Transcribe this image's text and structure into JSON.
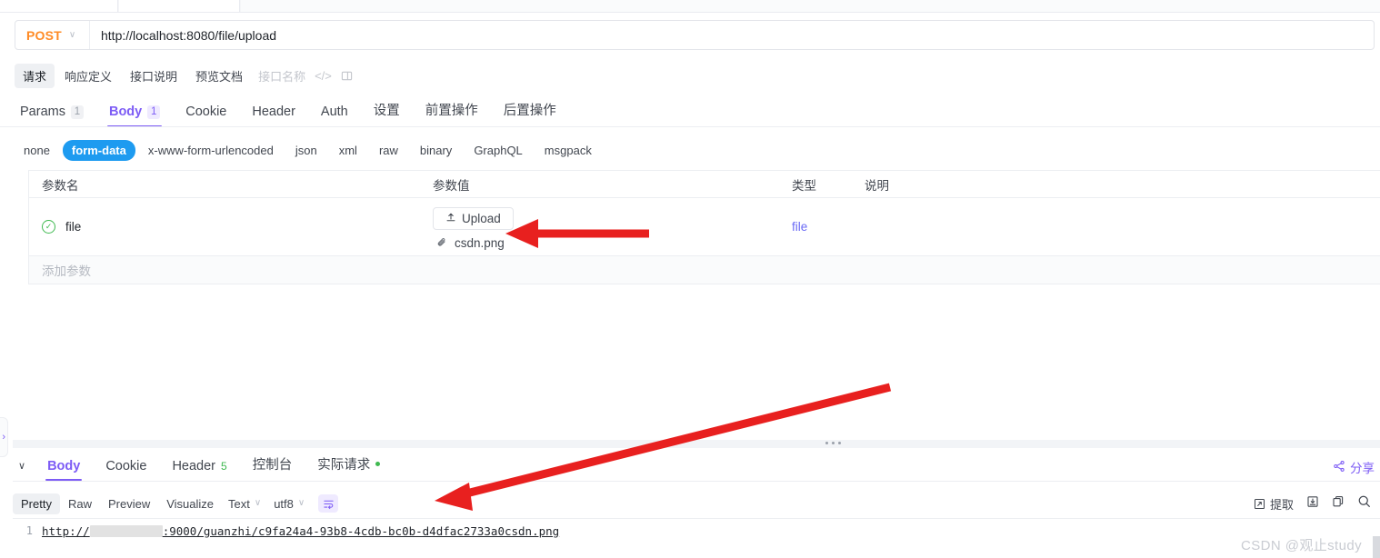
{
  "top_tabs": [
    {
      "label": "",
      "active": false
    },
    {
      "label": "",
      "active": true
    },
    {
      "label": "",
      "active": false
    }
  ],
  "urlbar": {
    "method": "POST",
    "method_caret": "∨",
    "url": "http://localhost:8080/file/upload"
  },
  "doc_row": {
    "chips": [
      {
        "label": "请求",
        "active": true
      },
      {
        "label": "响应定义",
        "active": false
      },
      {
        "label": "接口说明",
        "active": false
      },
      {
        "label": "预览文档",
        "active": false
      }
    ],
    "name_placeholder": "接口名称",
    "code_icon": "</>",
    "panel_icon": "▧"
  },
  "request_tabs": [
    {
      "label": "Params",
      "badge": "1",
      "active": false
    },
    {
      "label": "Body",
      "badge": "1",
      "active": true
    },
    {
      "label": "Cookie",
      "badge": "",
      "active": false
    },
    {
      "label": "Header",
      "badge": "",
      "active": false
    },
    {
      "label": "Auth",
      "badge": "",
      "active": false
    },
    {
      "label": "设置",
      "badge": "",
      "active": false
    },
    {
      "label": "前置操作",
      "badge": "",
      "active": false
    },
    {
      "label": "后置操作",
      "badge": "",
      "active": false
    }
  ],
  "body_types": [
    {
      "label": "none",
      "active": false
    },
    {
      "label": "form-data",
      "active": true
    },
    {
      "label": "x-www-form-urlencoded",
      "active": false
    },
    {
      "label": "json",
      "active": false
    },
    {
      "label": "xml",
      "active": false
    },
    {
      "label": "raw",
      "active": false
    },
    {
      "label": "binary",
      "active": false
    },
    {
      "label": "GraphQL",
      "active": false
    },
    {
      "label": "msgpack",
      "active": false
    }
  ],
  "params_table": {
    "headers": {
      "name": "参数名",
      "value": "参数值",
      "type": "类型",
      "desc": "说明"
    },
    "row": {
      "check_glyph": "✓",
      "name": "file",
      "upload_label": "Upload",
      "upload_icon": "⤒",
      "file_icon": "📎",
      "file_name": "csdn.png",
      "type": "file",
      "desc": ""
    },
    "add_placeholder": "添加参数"
  },
  "left_collapse": {
    "glyph": "›"
  },
  "response": {
    "collapse_caret": "∨",
    "tabs": [
      {
        "label": "Body",
        "count": "",
        "dot": false,
        "active": true
      },
      {
        "label": "Cookie",
        "count": "",
        "dot": false,
        "active": false
      },
      {
        "label": "Header",
        "count": "5",
        "dot": false,
        "active": false
      },
      {
        "label": "控制台",
        "count": "",
        "dot": false,
        "active": false
      },
      {
        "label": "实际请求",
        "count": "",
        "dot": true,
        "active": false
      }
    ],
    "share_label": "分享",
    "toolbar": {
      "view_modes": [
        {
          "label": "Pretty",
          "active": true
        },
        {
          "label": "Raw",
          "active": false
        },
        {
          "label": "Preview",
          "active": false
        },
        {
          "label": "Visualize",
          "active": false
        }
      ],
      "format_select": "Text",
      "encoding_select": "utf8",
      "wrap_icon": "wrap-text-icon",
      "extract_label": "提取"
    },
    "body": {
      "line_number": "1",
      "url_prefix": "http://",
      "url_suffix": ":9000/guanzhi/c9fa24a4-93b8-4cdb-bc0b-d4dfac2733a0csdn.png"
    }
  },
  "watermark": "CSDN @观止study",
  "annotations": {
    "arrow1": {
      "name": "arrow-to-filename",
      "color": "#e8201f"
    },
    "arrow2": {
      "name": "arrow-to-response-body",
      "color": "#e8201f"
    }
  },
  "colors": {
    "accent_purple": "#7d5cf5",
    "method_orange": "#ff8b25",
    "chip_blue": "#1e9bf0",
    "success_green": "#3fb950",
    "annotation_red": "#e8201f"
  }
}
